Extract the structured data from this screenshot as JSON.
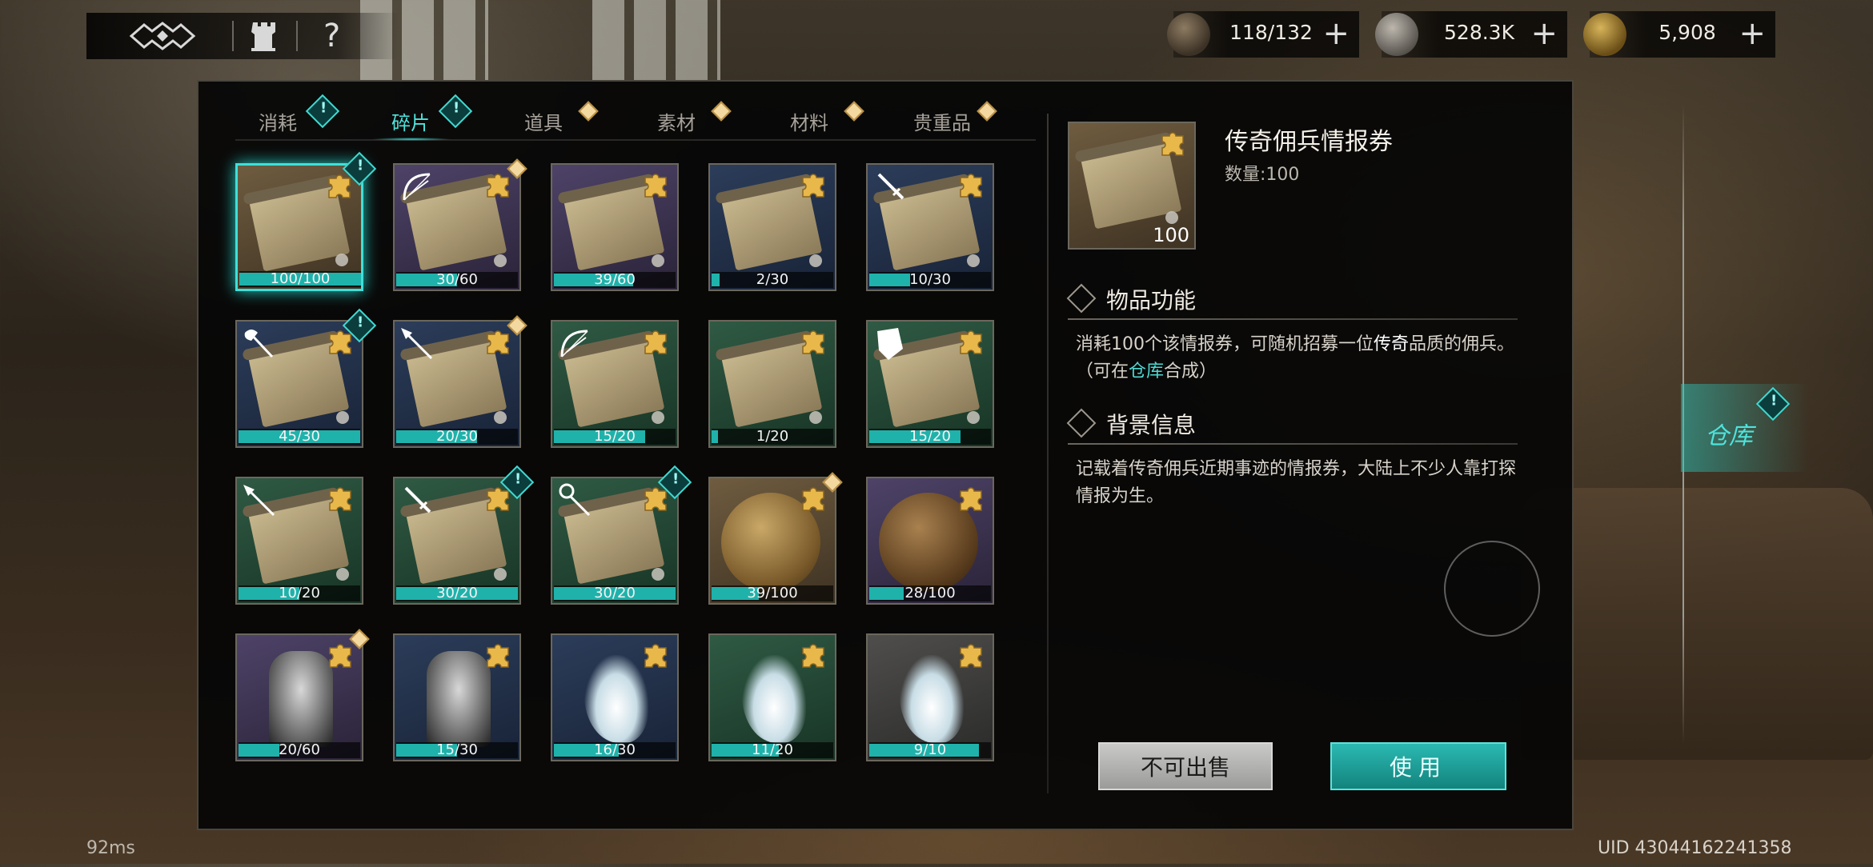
{
  "resources": [
    {
      "icon": "antler-resource-icon",
      "value": "118/132"
    },
    {
      "icon": "silver-coin-icon",
      "value": "528.3K"
    },
    {
      "icon": "gold-feather-icon",
      "value": "5,908"
    }
  ],
  "tabs": [
    {
      "label": "消耗",
      "badge": "teal"
    },
    {
      "label": "碎片",
      "badge": "teal",
      "active": true
    },
    {
      "label": "道具",
      "badge": "gold"
    },
    {
      "label": "素材",
      "badge": "gold"
    },
    {
      "label": "材料",
      "badge": "gold"
    },
    {
      "label": "贵重品",
      "badge": "gold"
    }
  ],
  "items": [
    {
      "count": "100/100",
      "progress": 1.0,
      "rarity": "brown",
      "art": "scroll",
      "weapon": "",
      "badge": "teal",
      "selected": true
    },
    {
      "count": "30/60",
      "progress": 0.5,
      "rarity": "purple",
      "art": "scroll",
      "weapon": "bow-icon",
      "badge": "gold"
    },
    {
      "count": "39/60",
      "progress": 0.65,
      "rarity": "purple",
      "art": "scroll",
      "weapon": "",
      "badge": ""
    },
    {
      "count": "2/30",
      "progress": 0.067,
      "rarity": "blue",
      "art": "scroll",
      "weapon": "",
      "badge": ""
    },
    {
      "count": "10/30",
      "progress": 0.333,
      "rarity": "blue",
      "art": "scroll",
      "weapon": "sword-icon",
      "badge": ""
    },
    {
      "count": "45/30",
      "progress": 1.0,
      "rarity": "blue",
      "art": "scroll",
      "weapon": "axe-icon",
      "badge": "teal"
    },
    {
      "count": "20/30",
      "progress": 0.667,
      "rarity": "blue",
      "art": "scroll",
      "weapon": "spear-icon",
      "badge": "gold"
    },
    {
      "count": "15/20",
      "progress": 0.75,
      "rarity": "green",
      "art": "scroll",
      "weapon": "bow-icon",
      "badge": ""
    },
    {
      "count": "1/20",
      "progress": 0.05,
      "rarity": "green",
      "art": "scroll",
      "weapon": "",
      "badge": ""
    },
    {
      "count": "15/20",
      "progress": 0.75,
      "rarity": "green",
      "art": "scroll",
      "weapon": "shield-icon",
      "badge": ""
    },
    {
      "count": "10/20",
      "progress": 0.5,
      "rarity": "green",
      "art": "scroll",
      "weapon": "spear-icon",
      "badge": ""
    },
    {
      "count": "30/20",
      "progress": 1.0,
      "rarity": "green",
      "art": "scroll",
      "weapon": "sword-icon",
      "badge": "teal"
    },
    {
      "count": "30/20",
      "progress": 1.0,
      "rarity": "green",
      "art": "scroll",
      "weapon": "staff-icon",
      "badge": "teal"
    },
    {
      "count": "39/100",
      "progress": 0.39,
      "rarity": "brown",
      "art": "coin",
      "weapon": "",
      "badge": "gold"
    },
    {
      "count": "28/100",
      "progress": 0.28,
      "rarity": "purple",
      "art": "coin-dark",
      "weapon": "",
      "badge": ""
    },
    {
      "count": "20/60",
      "progress": 0.333,
      "rarity": "purple",
      "art": "figure",
      "weapon": "",
      "badge": "gold"
    },
    {
      "count": "15/30",
      "progress": 0.5,
      "rarity": "blue",
      "art": "figure",
      "weapon": "",
      "badge": ""
    },
    {
      "count": "16/30",
      "progress": 0.533,
      "rarity": "blue",
      "art": "wisp",
      "weapon": "",
      "badge": ""
    },
    {
      "count": "11/20",
      "progress": 0.55,
      "rarity": "green",
      "art": "wisp",
      "weapon": "",
      "badge": ""
    },
    {
      "count": "9/10",
      "progress": 0.9,
      "rarity": "grey",
      "art": "wisp",
      "weapon": "",
      "badge": ""
    }
  ],
  "detail": {
    "name": "传奇佣兵情报券",
    "quantity_label": "数量:100",
    "icon_qty": "100",
    "function_title": "物品功能",
    "function_text": {
      "p1": "消耗100个该情报券，可随机招募一位",
      "highlight1": "传奇",
      "p2": "品质的佣兵。（可在",
      "highlight2": "仓库",
      "p3": "合成）"
    },
    "background_title": "背景信息",
    "background_text": "记载着传奇佣兵近期事迹的情报券，大陆上不少人靠打探情报为生。"
  },
  "buttons": {
    "not_sellable": "不可出售",
    "use": "使用"
  },
  "side": {
    "warehouse": "仓库"
  },
  "footer": {
    "ping": "92ms",
    "uid": "UID 43044162241358"
  },
  "colors": {
    "accent": "#3fe0d8",
    "gold_badge": "#f3d9a0"
  }
}
